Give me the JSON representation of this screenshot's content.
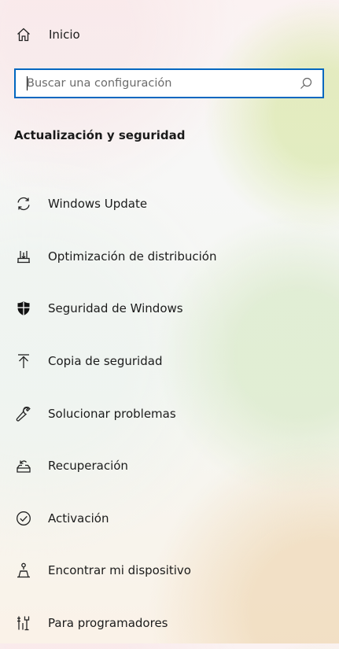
{
  "home": {
    "label": "Inicio",
    "icon": "home-icon"
  },
  "search": {
    "placeholder": "Buscar una configuración",
    "value": "",
    "icon": "search-icon",
    "border_color": "#0067c0"
  },
  "section": {
    "title": "Actualización y seguridad"
  },
  "nav": {
    "items": [
      {
        "label": "Windows Update",
        "icon": "sync-icon"
      },
      {
        "label": "Optimización de distribución",
        "icon": "delivery-optimization-icon"
      },
      {
        "label": "Seguridad de Windows",
        "icon": "shield-icon"
      },
      {
        "label": "Copia de seguridad",
        "icon": "backup-upload-icon"
      },
      {
        "label": "Solucionar problemas",
        "icon": "wrench-icon"
      },
      {
        "label": "Recuperación",
        "icon": "recovery-icon"
      },
      {
        "label": "Activación",
        "icon": "check-circle-icon"
      },
      {
        "label": "Encontrar mi dispositivo",
        "icon": "find-device-icon"
      },
      {
        "label": "Para programadores",
        "icon": "developer-tools-icon"
      }
    ]
  }
}
